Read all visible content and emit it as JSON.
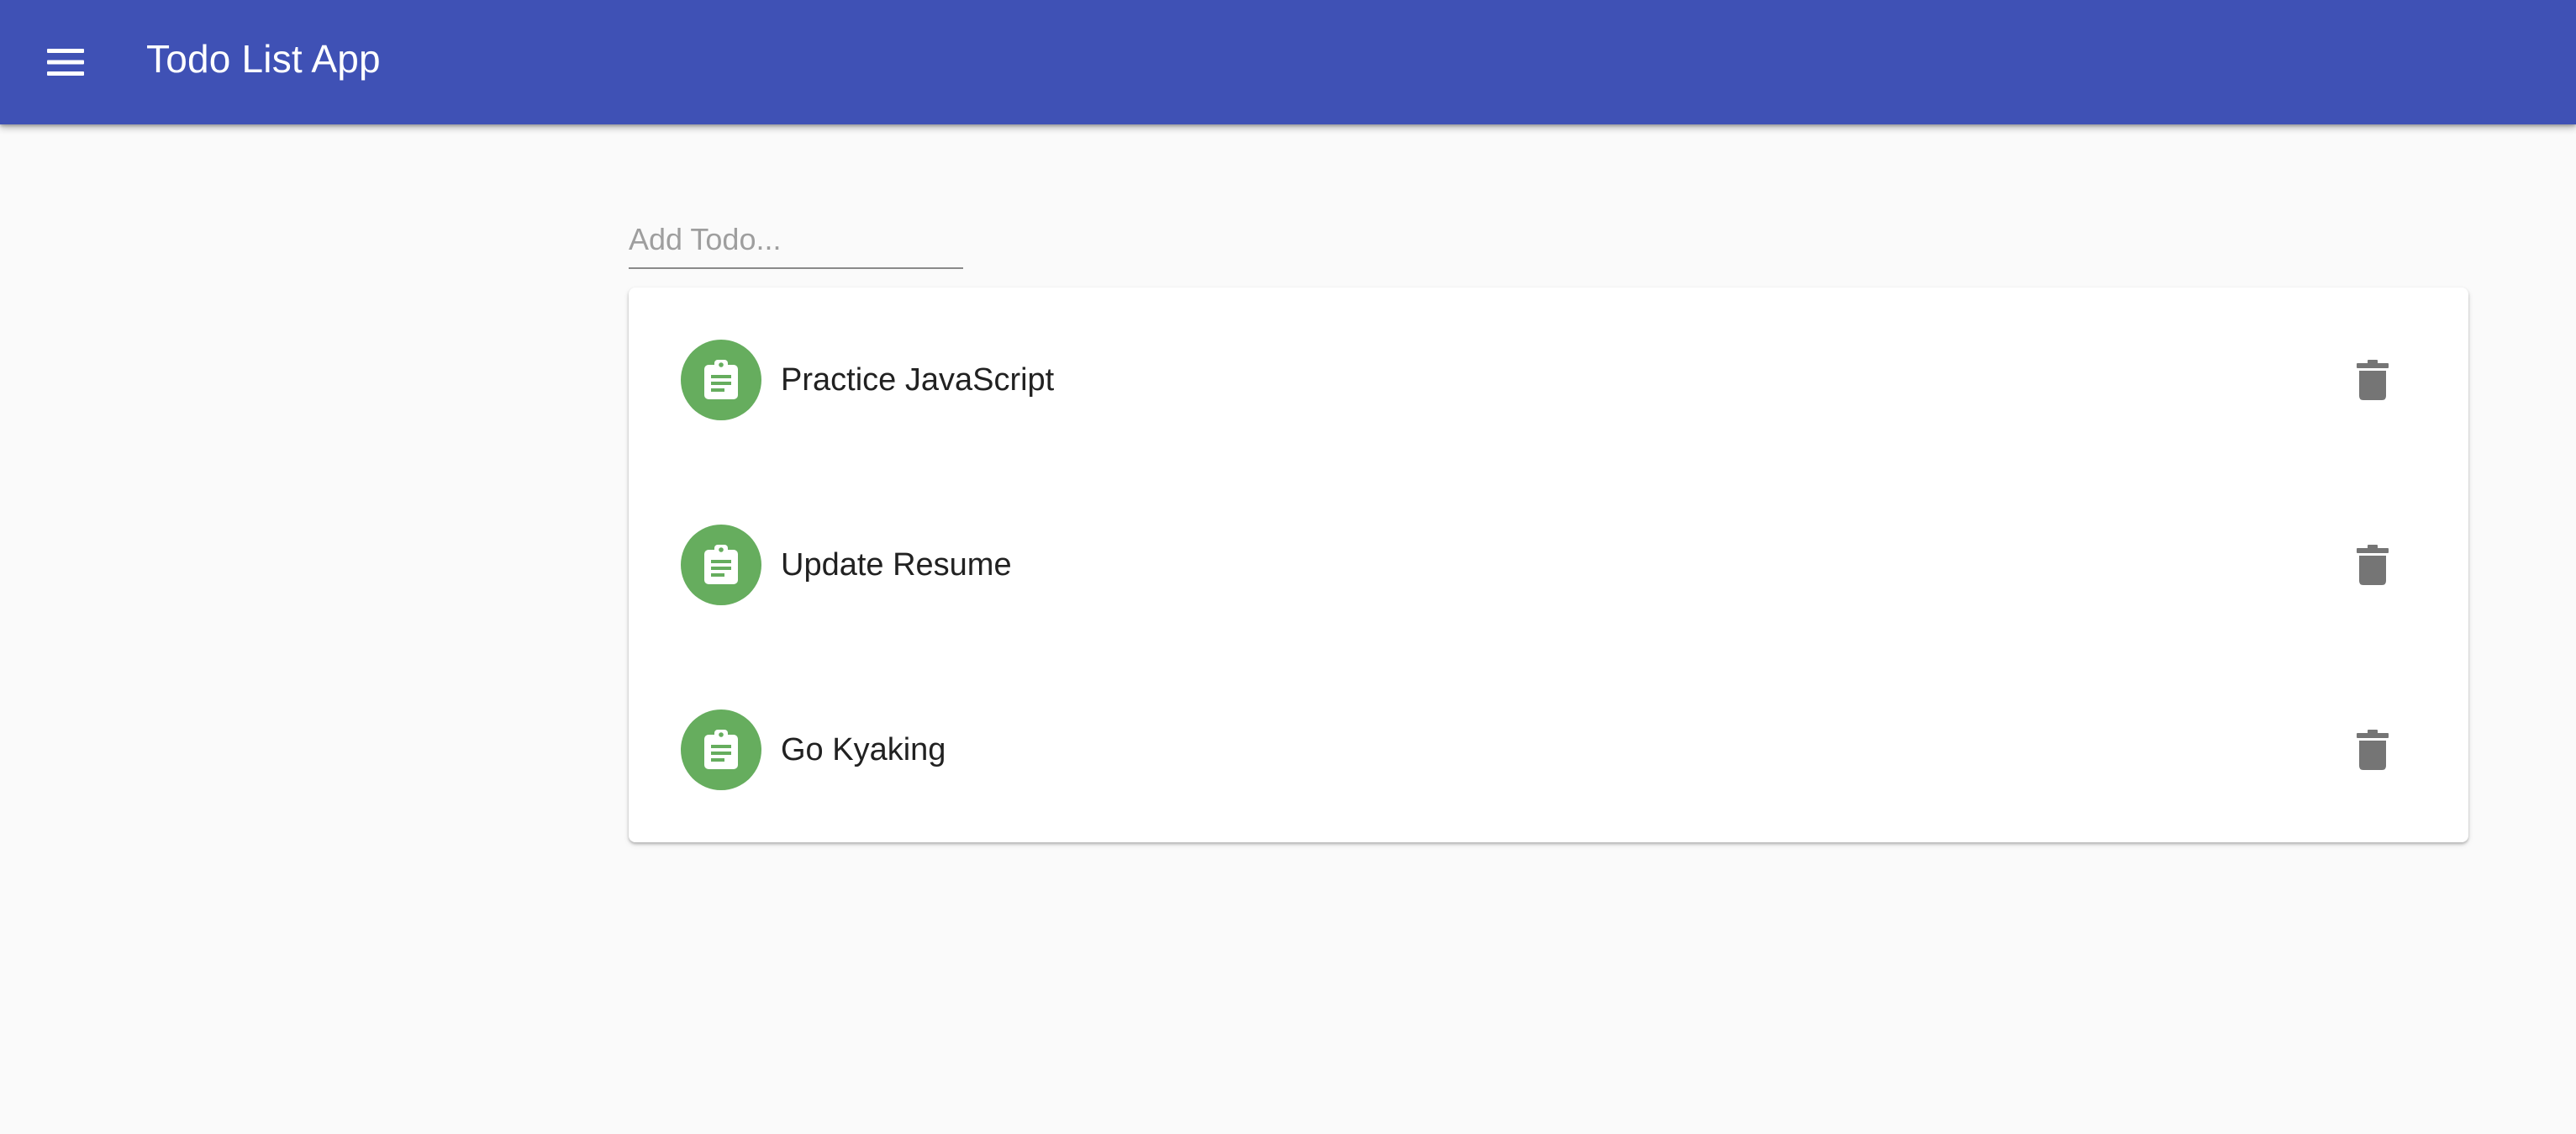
{
  "app_bar": {
    "title": "Todo List App",
    "menu_icon": "menu-icon",
    "color": "#3f51b5"
  },
  "add_todo": {
    "placeholder": "Add Todo...",
    "value": ""
  },
  "todos": [
    {
      "text": "Practice JavaScript",
      "icon": "assignment-icon",
      "action_icon": "delete-icon"
    },
    {
      "text": "Update Resume",
      "icon": "assignment-icon",
      "action_icon": "delete-icon"
    },
    {
      "text": "Go Kyaking",
      "icon": "assignment-icon",
      "action_icon": "delete-icon"
    }
  ],
  "colors": {
    "avatar": "#66ad5e",
    "delete_icon": "#757575",
    "background": "#fafafa"
  }
}
